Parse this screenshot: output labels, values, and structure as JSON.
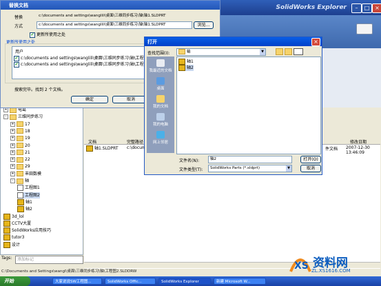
{
  "explorer": {
    "title": "SolidWorks Explorer",
    "tree": [
      {
        "label": "电葛",
        "type": "folder",
        "indent": 0,
        "exp": "+"
      },
      {
        "label": "三维同步练习",
        "type": "folder",
        "indent": 0,
        "exp": "-"
      },
      {
        "label": "17",
        "type": "folder",
        "indent": 1,
        "exp": "+"
      },
      {
        "label": "18",
        "type": "folder",
        "indent": 1,
        "exp": "+"
      },
      {
        "label": "19",
        "type": "folder",
        "indent": 1,
        "exp": "+"
      },
      {
        "label": "20",
        "type": "folder",
        "indent": 1,
        "exp": "+"
      },
      {
        "label": "21",
        "type": "folder",
        "indent": 1,
        "exp": "+"
      },
      {
        "label": "22",
        "type": "folder",
        "indent": 1,
        "exp": "+"
      },
      {
        "label": "29",
        "type": "folder",
        "indent": 1,
        "exp": "+"
      },
      {
        "label": "丰田数模",
        "type": "folder",
        "indent": 1,
        "exp": "+"
      },
      {
        "label": "轴",
        "type": "folder",
        "indent": 1,
        "exp": "-"
      },
      {
        "label": "工程图1",
        "type": "drw",
        "indent": 2,
        "exp": ""
      },
      {
        "label": "工程图2",
        "type": "drw",
        "indent": 2,
        "exp": "",
        "selected": true
      },
      {
        "label": "轴1",
        "type": "part",
        "indent": 2,
        "exp": ""
      },
      {
        "label": "轴2",
        "type": "part",
        "indent": 2,
        "exp": ""
      },
      {
        "label": "3d_lol",
        "type": "part",
        "indent": 0,
        "exp": ""
      },
      {
        "label": "CCTV大厦",
        "type": "part",
        "indent": 0,
        "exp": ""
      },
      {
        "label": "SolidWorks应用技巧",
        "type": "part",
        "indent": 0,
        "exp": ""
      },
      {
        "label": "tutor3",
        "type": "part",
        "indent": 0,
        "exp": ""
      },
      {
        "label": "设计",
        "type": "part",
        "indent": 0,
        "exp": ""
      }
    ],
    "tags_label": "Tags:",
    "tags_placeholder": "添加标记",
    "status_path": "C:\\Documents and Settings\\wangl\\桌面\\三维同步练习\\轴\\工程图2.SLDDRW",
    "results_headers": [
      "文档",
      "完整路径",
      "修改日期"
    ],
    "results_row": {
      "doc": "轴1.SLDPRT",
      "path": "c:\\docum",
      "type": "件文档",
      "date": "2007-12-30 13:46:09"
    }
  },
  "replace_dialog": {
    "title": "替换文档",
    "replace_label": "替换",
    "replace_value": "c:\\documents and settings\\wanglili\\桌面\\三维同步练习\\轴\\轴1.SLDPRT",
    "method_label": "方式",
    "method_value": "c:\\documents and settings\\wanglili\\桌面\\三维同步练习\\轴\\轴1.SLDPRT",
    "browse_label": "浏览...",
    "update_checkbox_label": "更新所使用之处",
    "group_label": "更新所使用之处",
    "list_header": "用户",
    "list_items": [
      "c:\\documents and settings\\wanglili\\桌面\\三维同步练习\\轴\\工程",
      "c:\\documents and settings\\wanglili\\桌面\\三维同步练习\\轴\\工程"
    ],
    "status": "搜索完毕。找到 2 个文档。",
    "ok_label": "确定",
    "cancel_label": "取消"
  },
  "open_dialog": {
    "title": "打开",
    "lookin_label": "查找范围(I):",
    "lookin_value": "轴",
    "places": [
      "我最近的文档",
      "桌面",
      "我的文档",
      "我的电脑",
      "网上邻居"
    ],
    "files": [
      "轴1",
      "轴2"
    ],
    "filename_label": "文件名(N):",
    "filename_value": "轴2",
    "filetype_label": "文件类型(T):",
    "filetype_value": "SolidWorks Parts (*.sldprt)",
    "open_label": "打开(O)",
    "cancel_label": "取消"
  },
  "taskbar": {
    "start_label": "开始",
    "tasks": [
      "大家说说SW工程图...",
      "SolidWorks Offic...",
      "SolidWorks Explorer",
      "新建 Microsoft W..."
    ]
  },
  "watermark": {
    "text": "资料网",
    "url": "ZL.XS1616.COM"
  }
}
